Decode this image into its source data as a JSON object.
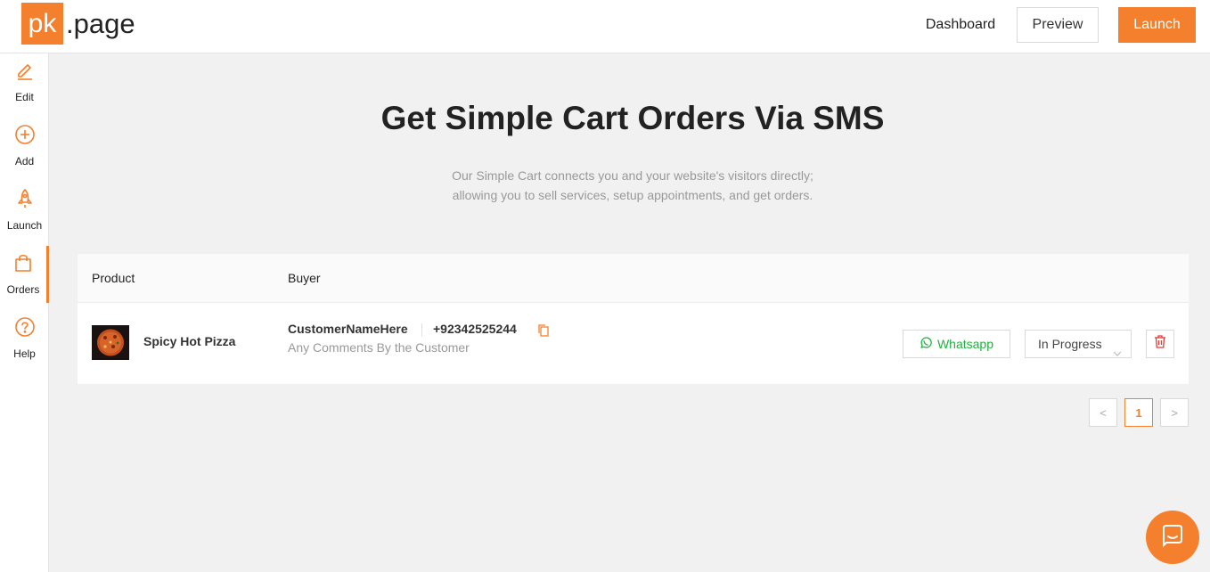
{
  "header": {
    "logo_mark": "pk",
    "logo_rest": ".page",
    "dashboard_label": "Dashboard",
    "preview_label": "Preview",
    "launch_label": "Launch"
  },
  "sidebar": {
    "items": [
      {
        "label": "Edit",
        "icon": "pencil-icon"
      },
      {
        "label": "Add",
        "icon": "plus-circle-icon"
      },
      {
        "label": "Launch",
        "icon": "rocket-icon"
      },
      {
        "label": "Orders",
        "icon": "shopping-bag-icon",
        "active": true
      },
      {
        "label": "Help",
        "icon": "question-circle-icon"
      }
    ]
  },
  "main": {
    "title": "Get Simple Cart Orders Via SMS",
    "subtitle_line1": "Our Simple Cart connects you and your website's visitors directly;",
    "subtitle_line2": "allowing you to sell services, setup appointments, and get orders."
  },
  "orders_table": {
    "columns": [
      "Product",
      "Buyer"
    ],
    "rows": [
      {
        "product": "Spicy Hot Pizza",
        "customer_name": "CustomerNameHere",
        "phone": "+92342525244",
        "comment": "Any Comments By the Customer",
        "whatsapp_label": "Whatsapp",
        "status": "In Progress"
      }
    ]
  },
  "pagination": {
    "current_page": "1",
    "prev": "<",
    "next": ">"
  },
  "colors": {
    "accent": "#f47f2c",
    "whatsapp": "#1fb13d",
    "delete": "#e53935"
  }
}
